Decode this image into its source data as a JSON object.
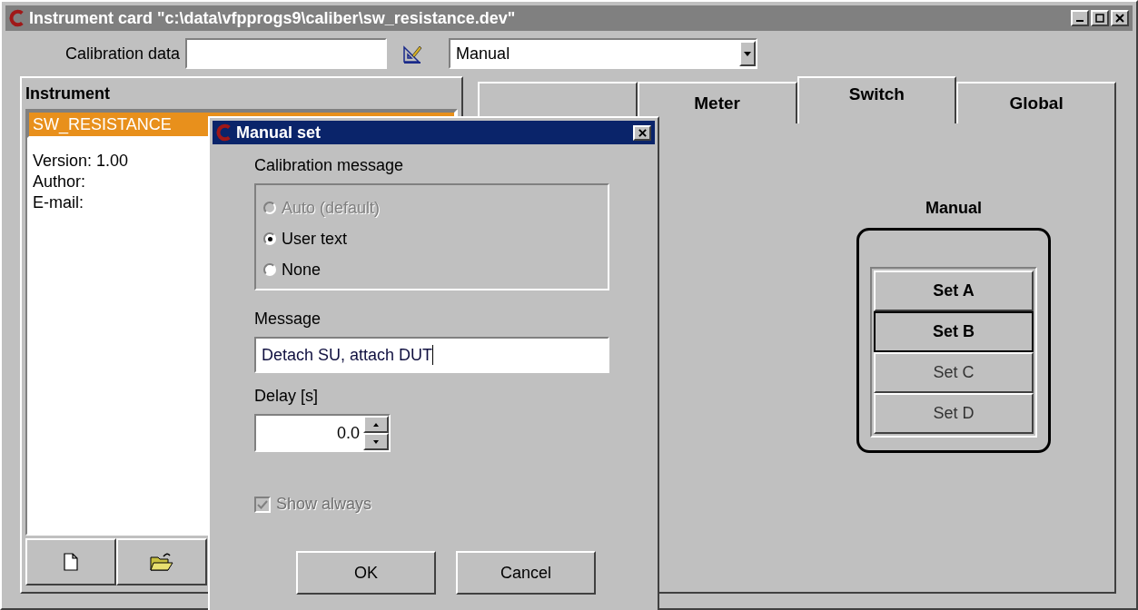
{
  "window": {
    "title": "Instrument card \"c:\\data\\vfpprogs9\\caliber\\sw_resistance.dev\""
  },
  "calibration": {
    "label": "Calibration data",
    "mode": "Manual"
  },
  "instrument_panel": {
    "header": "Instrument",
    "items": [
      {
        "label": "SW_RESISTANCE",
        "selected": true
      }
    ],
    "details": [
      "Version: 1.00",
      "Author:",
      "E-mail:"
    ]
  },
  "tabs": [
    {
      "selected": false
    },
    {
      "label": "Meter",
      "selected": false
    },
    {
      "label": "Switch",
      "selected": true
    },
    {
      "label": "Global",
      "selected": false
    }
  ],
  "switch_panel": {
    "title": "Manual",
    "buttons": [
      {
        "label": "Set A",
        "bold": true,
        "focused": false
      },
      {
        "label": "Set B",
        "bold": true,
        "focused": true
      },
      {
        "label": "Set C",
        "bold": false,
        "focused": false
      },
      {
        "label": "Set D",
        "bold": false,
        "focused": false
      }
    ]
  },
  "dialog": {
    "title": "Manual set",
    "group_label": "Calibration message",
    "radios": [
      {
        "label": "Auto (default)",
        "selected": false,
        "disabled": true
      },
      {
        "label": "User text",
        "selected": true,
        "disabled": false
      },
      {
        "label": "None",
        "selected": false,
        "disabled": false
      }
    ],
    "message_label": "Message",
    "message_value": "Detach SU, attach DUT",
    "delay_label": "Delay [s]",
    "delay_value": "0.0",
    "show_always": {
      "label": "Show always",
      "checked": true,
      "disabled": true
    },
    "buttons": [
      "OK",
      "Cancel"
    ]
  }
}
